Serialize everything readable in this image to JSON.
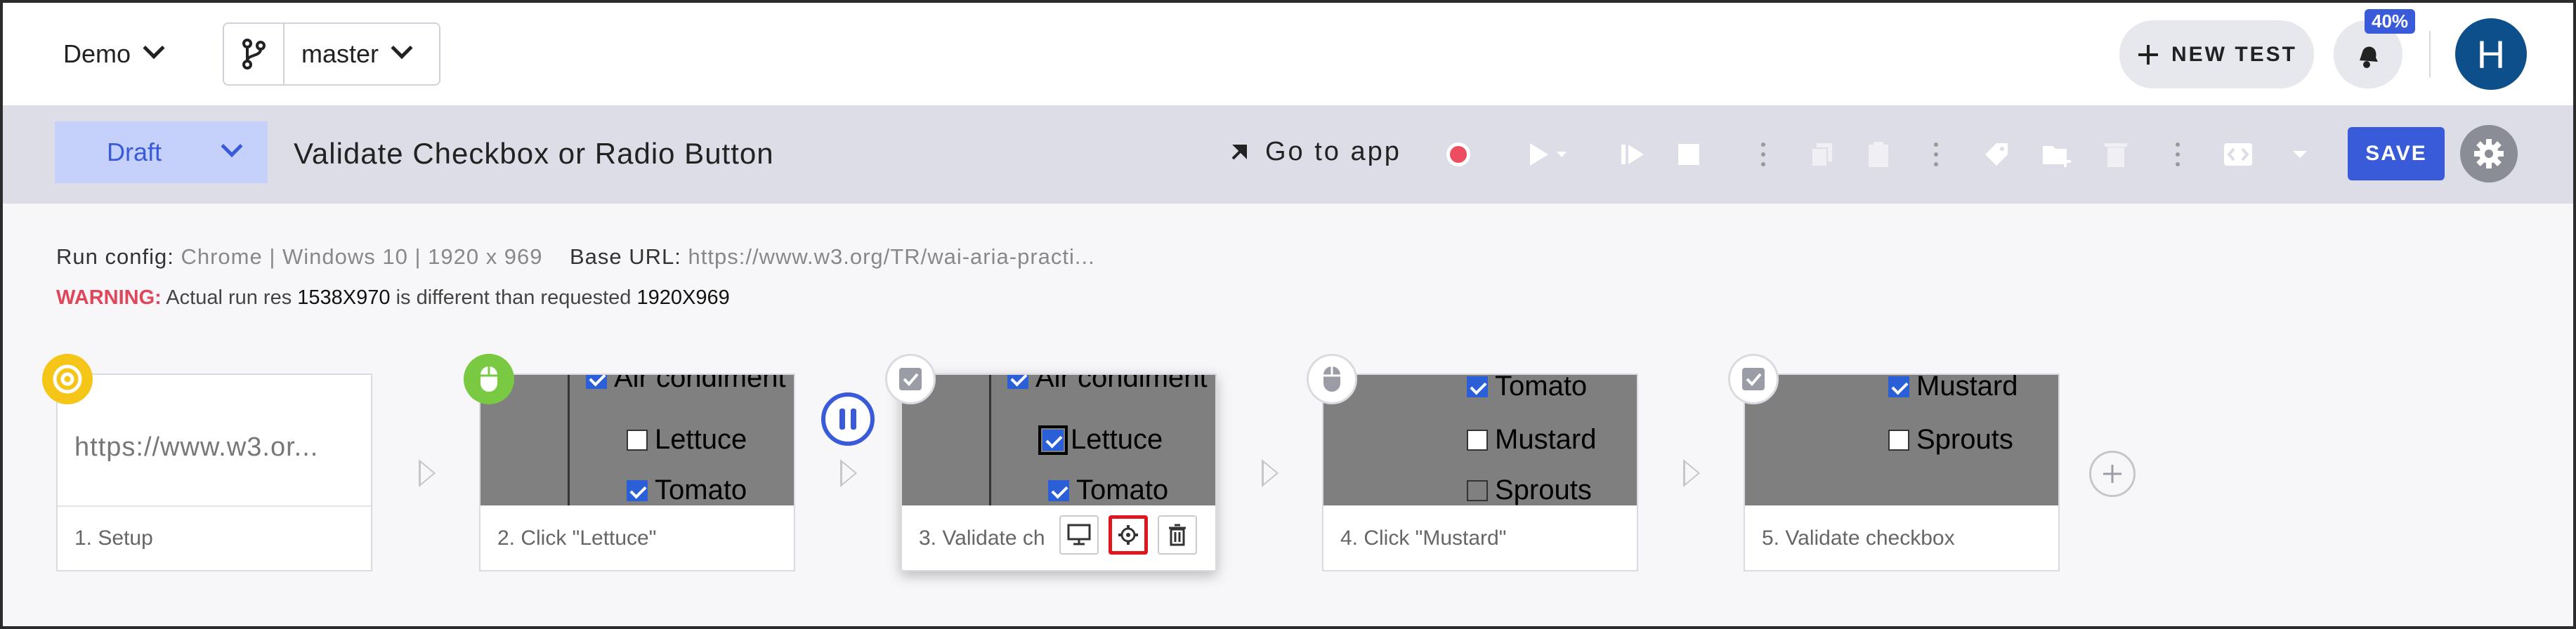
{
  "header": {
    "project": "Demo",
    "branch": "master",
    "new_test_label": "NEW TEST",
    "notification_badge": "40%",
    "avatar_initial": "H"
  },
  "toolbar": {
    "status": "Draft",
    "test_title": "Validate Checkbox or Radio Button",
    "go_to_app": "Go to app",
    "save_label": "SAVE"
  },
  "info": {
    "run_config_label": "Run config:",
    "run_config_value": "Chrome | Windows 10 | 1920 x 969",
    "base_url_label": "Base URL:",
    "base_url_value": "https://www.w3.org/TR/wai-aria-practi...",
    "warning_label": "WARNING:",
    "warning_text_1": "Actual run res",
    "actual_res": "1538X970",
    "warning_text_2": "is different than requested",
    "requested_res": "1920X969"
  },
  "steps": [
    {
      "label": "1. Setup",
      "url": "https://www.w3.or..."
    },
    {
      "label": "2. Click \"Lettuce\"",
      "lines": [
        "Air condiment",
        "Lettuce",
        "Tomato"
      ]
    },
    {
      "label": "3. Validate ch",
      "lines": [
        "Air condiment",
        "Lettuce",
        "Tomato"
      ]
    },
    {
      "label": "4. Click \"Mustard\"",
      "lines": [
        "Tomato",
        "Mustard",
        "Sprouts"
      ]
    },
    {
      "label": "5. Validate checkbox",
      "lines": [
        "Mustard",
        "Sprouts"
      ]
    }
  ],
  "colors": {
    "accent": "#3a5bd9",
    "warning": "#e0455a",
    "highlight": "#e0161c"
  }
}
